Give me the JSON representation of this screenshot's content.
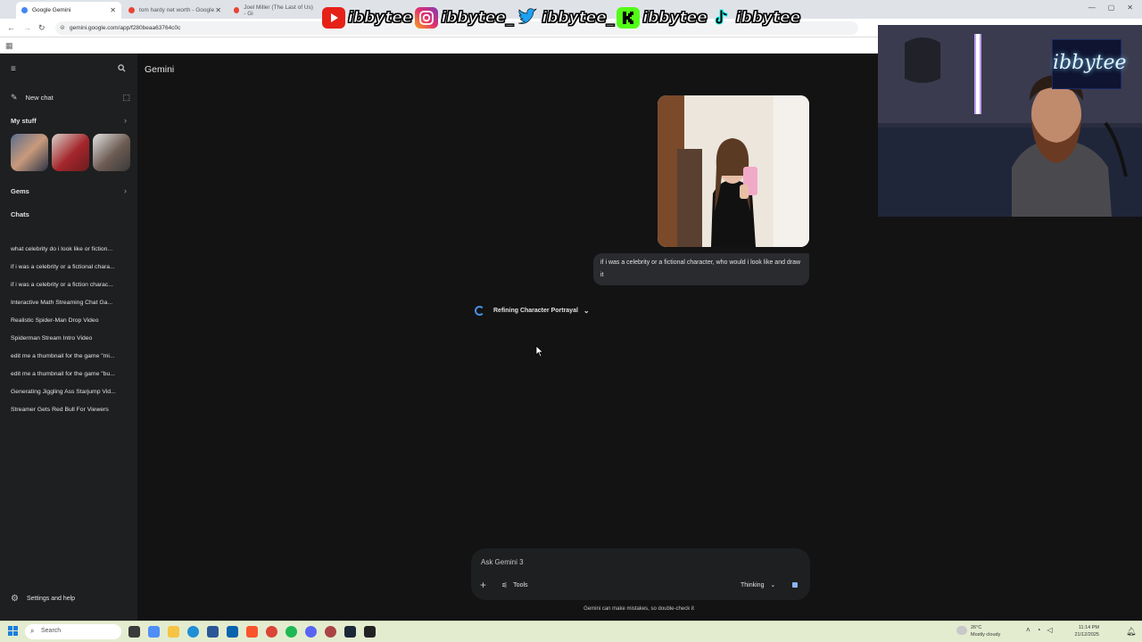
{
  "browser": {
    "tabs": [
      {
        "title": "Google Gemini",
        "active": true
      },
      {
        "title": "tom hardy net worth - Google",
        "active": false
      },
      {
        "title": "Joel Miller (The Last of Us) - Gi",
        "active": false
      }
    ],
    "url": "gemini.google.com/app/f280beaa63764c0c"
  },
  "sidebar": {
    "new_chat": "New chat",
    "my_stuff": "My stuff",
    "gems": "Gems",
    "chats_header": "Chats",
    "chats": [
      "what celebrity do i look like or fiction...",
      "if i was a celebrity or a fictional chara...",
      "if i was a celebrity or a fiction charac...",
      "Interactive Math Streaming Chat Ga...",
      "Realistic Spider-Man Drop Video",
      "Spiderman Stream Intro Video",
      "edit me a thumbnail for the game \"mi...",
      "edit me a thumbnail for the game \"bu...",
      "Generating Jiggling Ass Starjump Vid...",
      "Streamer Gets Red Bull For Viewers"
    ],
    "settings": "Settings and help"
  },
  "main": {
    "brand": "Gemini",
    "user_message": "if i was a celebrity or a fictional character, who would i look like and draw it",
    "thinking_status": "Refining Character Portrayal",
    "composer": {
      "placeholder": "Ask Gemini 3",
      "tools_label": "Tools",
      "mode_label": "Thinking"
    },
    "disclaimer": "Gemini can make mistakes, so double-check it"
  },
  "overlay": {
    "handles": [
      "ibbytee",
      "ibbytee_",
      "ibbytee_",
      "ibbytee",
      "ibbytee"
    ],
    "icons": [
      "youtube-icon",
      "instagram-icon",
      "twitter-icon",
      "kick-icon",
      "tiktok-icon"
    ],
    "neon_sign": "ibbytee"
  },
  "taskbar": {
    "search": "Search",
    "weather_temp": "26°C",
    "weather_desc": "Mostly cloudy",
    "time": "11:14 PM",
    "date": "21/12/2025"
  },
  "colors": {
    "background": "#131314",
    "sidebar": "#1e1f20",
    "accent": "#8ab4f8",
    "spinner": "#4a90e2"
  }
}
